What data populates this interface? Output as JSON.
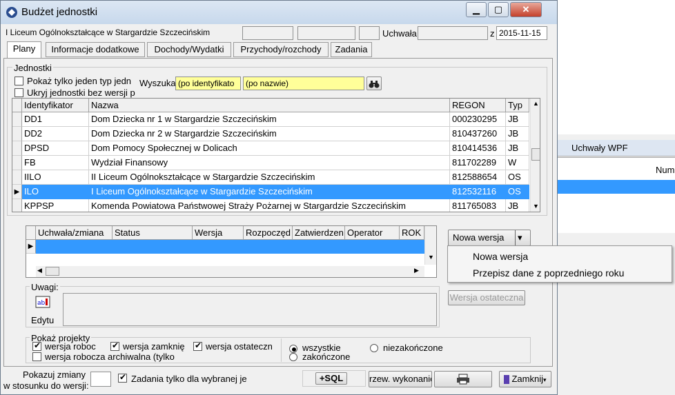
{
  "window": {
    "title": "Budżet jednostki"
  },
  "header": {
    "unit_name": "I Liceum Ogólnokształcące w Stargardzie Szczecińskim",
    "uchwala_label": "Uchwała",
    "z_label": "z",
    "date": "2015-11-15"
  },
  "tabs": [
    "Plany",
    "Informacje dodatkowe",
    "Dochody/Wydatki",
    "Przychody/rozchody",
    "Zadania"
  ],
  "jednostki": {
    "group_label": "Jednostki",
    "show_one_type_label": "Pokaż tylko jeden typ jedn",
    "hide_without_version_label": "Ukryj jednostki bez wersji p",
    "search_label": "Wyszuka",
    "search_id_placeholder": "(po identyfikato",
    "search_name_placeholder": "(po nazwie)",
    "columns": [
      "Identyfikator",
      "Nazwa",
      "REGON",
      "Typ"
    ],
    "rows": [
      {
        "id": "DD1",
        "name": "Dom Dziecka nr 1 w Stargardzie Szczecińskim",
        "regon": "000230295",
        "typ": "JB"
      },
      {
        "id": "DD2",
        "name": "Dom Dziecka nr 2 w Stargardzie Szczecińskim",
        "regon": "810437260",
        "typ": "JB"
      },
      {
        "id": "DPSD",
        "name": "Dom Pomocy Społecznej w Dolicach",
        "regon": "810414536",
        "typ": "JB"
      },
      {
        "id": "FB",
        "name": "Wydział Finansowy",
        "regon": "811702289",
        "typ": "W"
      },
      {
        "id": "IILO",
        "name": "II Liceum Ogólnokształcące w Stargardzie Szczecińskim",
        "regon": "812588654",
        "typ": "OS"
      },
      {
        "id": "ILO",
        "name": "I Liceum Ogólnokształcące w Stargardzie Szczecińskim",
        "regon": "812532116",
        "typ": "OS"
      },
      {
        "id": "KPPSP",
        "name": "Komenda Powiatowa Państwowej Straży Pożarnej w Stargardzie Szczecińskim",
        "regon": "811765083",
        "typ": "JB"
      }
    ]
  },
  "versions": {
    "columns": [
      "Uchwała/zmiana",
      "Status",
      "Wersja",
      "Rozpoczęd",
      "Zatwierdzen",
      "Operator",
      "ROK"
    ]
  },
  "uwagi": {
    "label": "Uwagi:",
    "edit_label": "Edytu"
  },
  "buttons": {
    "nowa_wersja": "Nowa wersja",
    "wersja_ostateczna": "Wersja ostateczna",
    "sql": "+SQL",
    "przew": "rzew. wykonanie",
    "zamknij": "Zamknij"
  },
  "menu": {
    "items": [
      "Nowa wersja",
      "Przepisz dane z poprzedniego roku"
    ]
  },
  "pokaz": {
    "label": "Pokaż projekty",
    "wersja_robocza": "wersja roboc",
    "wersja_zamknieta": "wersja zamknię",
    "wersja_ostateczna": "wersja ostateczn",
    "wersja_archiwalna": "wersja robocza archiwalna (tylko",
    "wszystkie": "wszystkie",
    "zakonczone": "zakończone",
    "niezakonczone": "niezakończone"
  },
  "footer": {
    "pokaz_zmiany_line1": "Pokazuj zmiany",
    "pokaz_zmiany_line2": "w stosunku do wersji:",
    "zadania_label": "Zadania tylko dla wybranej je"
  },
  "background": {
    "uchwaly_wpf": "Uchwały WPF",
    "num_label": "Num"
  },
  "colors": {
    "selection": "#3399ff",
    "highlight_field": "#ffff99"
  }
}
